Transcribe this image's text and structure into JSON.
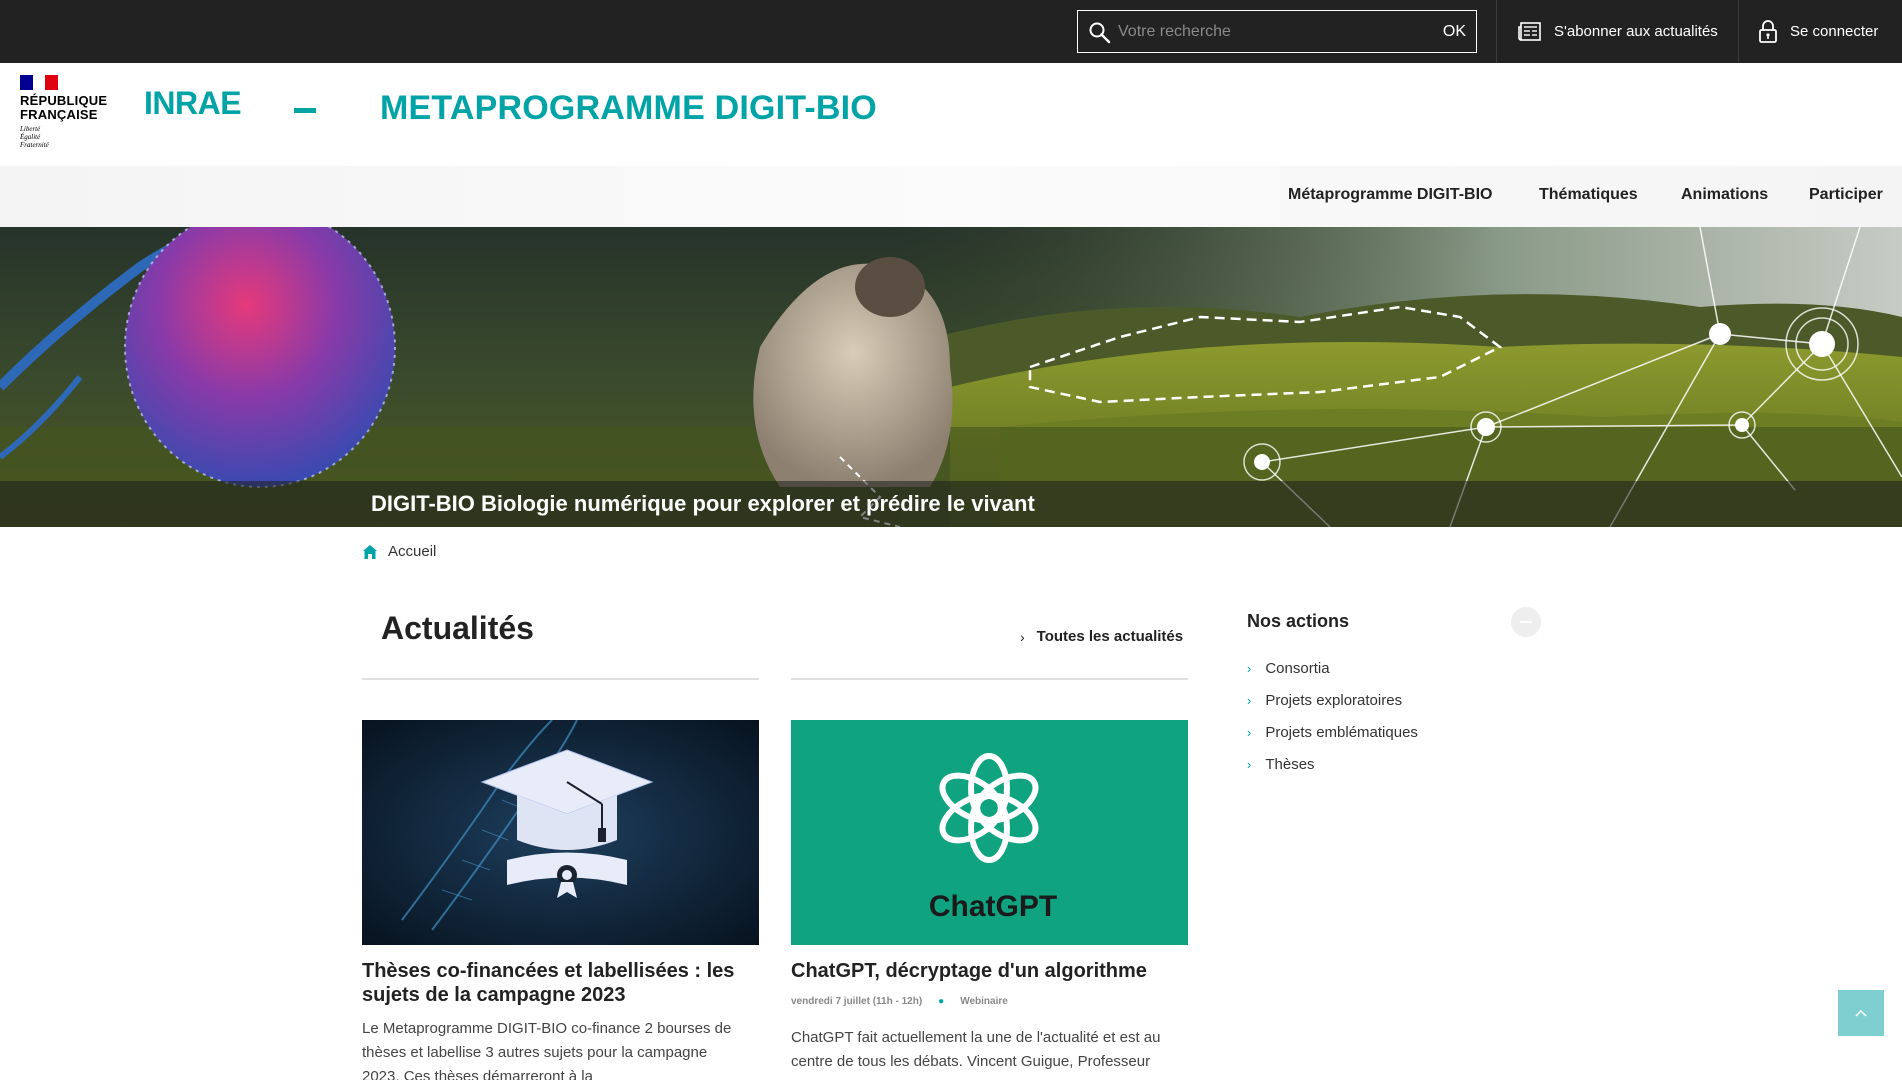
{
  "topbar": {
    "search_placeholder": "Votre recherche",
    "search_button": "OK",
    "subscribe_label": "S'abonner aux actualités",
    "login_label": "Se connecter"
  },
  "header": {
    "rf_line1": "RÉPUBLIQUE",
    "rf_line2": "FRANÇAISE",
    "rf_motto1": "Liberté",
    "rf_motto2": "Égalité",
    "rf_motto3": "Fraternité",
    "org_logo": "INRAE",
    "site_title": "METAPROGRAMME DIGIT-BIO"
  },
  "nav": {
    "items": [
      {
        "label": "Métaprogramme DIGIT-BIO"
      },
      {
        "label": "Thématiques"
      },
      {
        "label": "Animations"
      },
      {
        "label": "Participer"
      }
    ]
  },
  "banner": {
    "caption": "DIGIT-BIO Biologie numérique pour explorer et prédire le vivant"
  },
  "breadcrumb": {
    "home": "Accueil"
  },
  "news": {
    "title": "Actualités",
    "all_link": "Toutes les actualités",
    "cards": [
      {
        "title_line1": "Thèses co-financées et labellisées : les",
        "title_line2": "sujets de la campagne 2023",
        "text_line1": "Le Metaprogramme DIGIT-BIO co-finance 2 bourses de",
        "text_line2": "thèses et labellise 3 autres sujets pour la campagne",
        "text_line3": "2023. Ces thèses démarreront à la"
      },
      {
        "image_text": "ChatGPT",
        "title_line1": "ChatGPT, décryptage d'un algorithme",
        "date": "vendredi 7 juillet (11h - 12h)",
        "category": "Webinaire",
        "text_line1": "ChatGPT fait actuellement la une de l'actualité et est au",
        "text_line2": "centre de tous les débats. Vincent Guigue, Professeur"
      }
    ]
  },
  "actions": {
    "title": "Nos actions",
    "items": [
      {
        "label": "Consortia"
      },
      {
        "label": "Projets exploratoires"
      },
      {
        "label": "Projets emblématiques"
      },
      {
        "label": "Thèses"
      }
    ]
  },
  "colors": {
    "accent": "#00a3a6",
    "topbar": "#222222",
    "chatgpt_green": "#10a37f",
    "flag_blue": "#000091",
    "flag_red": "#e1000f"
  },
  "icons": {
    "search": "search-icon",
    "subscribe": "newspaper-icon",
    "login": "lock-icon",
    "home": "home-icon",
    "chevron": "chevron-right-icon",
    "top": "arrow-up-icon"
  }
}
